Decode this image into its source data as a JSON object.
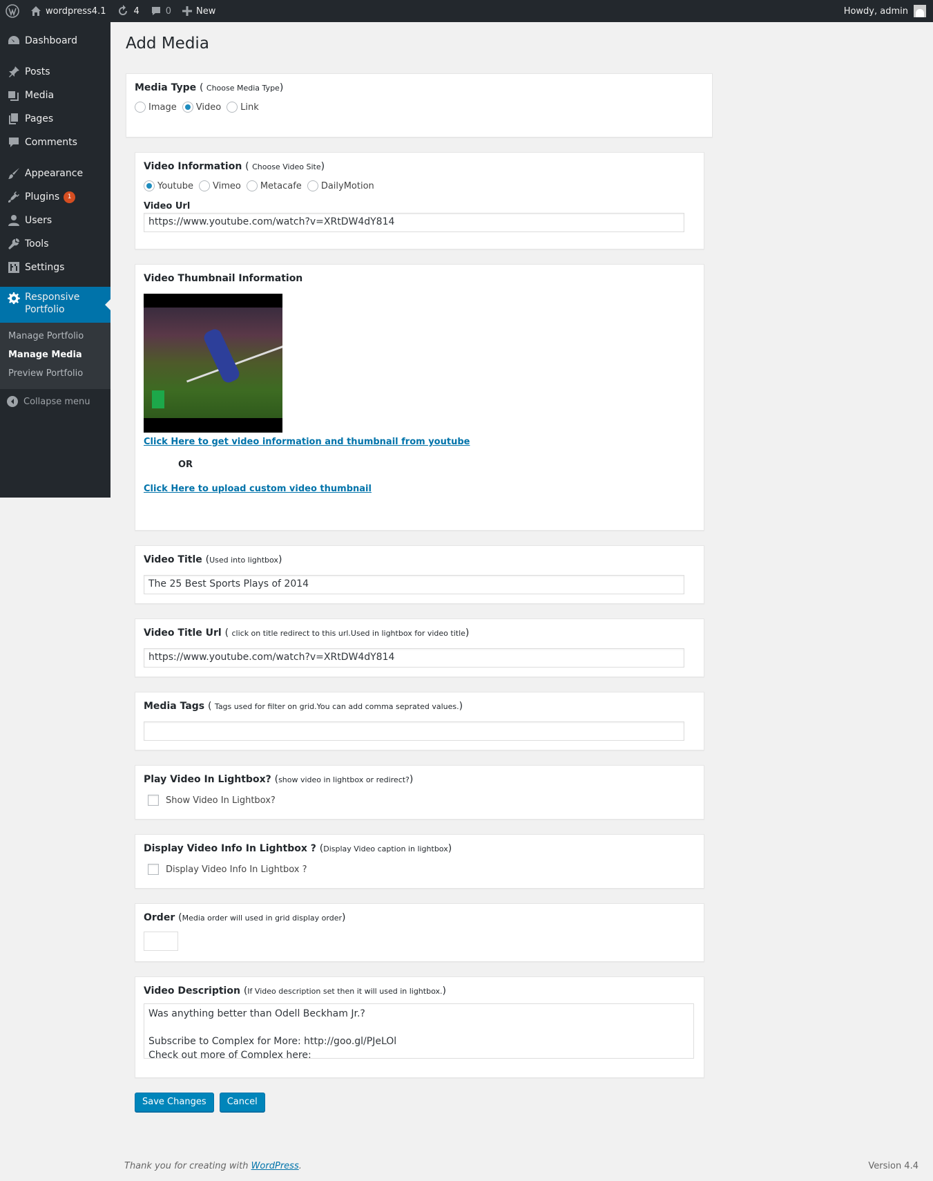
{
  "adminbar": {
    "site_name": "wordpress4.1",
    "updates_count": "4",
    "comments_count": "0",
    "new_label": "New",
    "howdy": "Howdy, admin"
  },
  "sidebar": {
    "items": [
      {
        "label": "Dashboard",
        "icon": "dashboard-icon"
      },
      {
        "label": "Posts",
        "icon": "pin-icon"
      },
      {
        "label": "Media",
        "icon": "media-icon"
      },
      {
        "label": "Pages",
        "icon": "pages-icon"
      },
      {
        "label": "Comments",
        "icon": "comment-icon"
      },
      {
        "label": "Appearance",
        "icon": "brush-icon"
      },
      {
        "label": "Plugins",
        "icon": "plug-icon",
        "badge": "1"
      },
      {
        "label": "Users",
        "icon": "user-icon"
      },
      {
        "label": "Tools",
        "icon": "wrench-icon"
      },
      {
        "label": "Settings",
        "icon": "settings-icon"
      },
      {
        "label": "Responsive Portfolio",
        "icon": "gear-icon"
      }
    ],
    "submenu": [
      "Manage Portfolio",
      "Manage Media",
      "Preview Portfolio"
    ],
    "collapse_label": "Collapse menu"
  },
  "page": {
    "title": "Add Media",
    "media_type": {
      "label": "Media Type",
      "hint": "Choose Media Type",
      "options": [
        "Image",
        "Video",
        "Link"
      ],
      "selected": "Video"
    },
    "video_info": {
      "label": "Video Information",
      "hint": "Choose Video Site",
      "options": [
        "Youtube",
        "Vimeo",
        "Metacafe",
        "DailyMotion"
      ],
      "selected": "Youtube",
      "url_label": "Video Url",
      "url_value": "https://www.youtube.com/watch?v=XRtDW4dY814"
    },
    "thumbnail": {
      "label": "Video Thumbnail Information",
      "link_youtube": "Click Here to get video information and thumbnail from youtube",
      "or": "OR",
      "link_upload": "Click Here to upload custom video thumbnail"
    },
    "video_title": {
      "label": "Video Title",
      "hint": "Used into lightbox",
      "value": "The 25 Best Sports Plays of 2014"
    },
    "video_title_url": {
      "label": "Video Title Url",
      "hint": "click on title redirect to this url.Used in lightbox for video title",
      "value": "https://www.youtube.com/watch?v=XRtDW4dY814"
    },
    "media_tags": {
      "label": "Media Tags",
      "hint": "Tags used for filter on grid.You can add comma seprated values.",
      "value": ""
    },
    "play_lightbox": {
      "label": "Play Video In Lightbox?",
      "hint": "show video in lightbox or redirect?",
      "checkbox_label": "Show Video In Lightbox?"
    },
    "display_info": {
      "label": "Display Video Info In Lightbox ?",
      "hint": "Display Video caption in lightbox",
      "checkbox_label": "Display Video Info In Lightbox ?"
    },
    "order": {
      "label": "Order",
      "hint": "Media order will used in grid display order",
      "value": ""
    },
    "description": {
      "label": "Video Description",
      "hint": "If Video description set then it will used in lightbox.",
      "line1": "Was anything better than Odell Beckham Jr.?",
      "line2": "",
      "line3": "Subscribe to Complex for More: http://goo.gl/PJeLOl",
      "line4": "Check out more of Complex here:"
    },
    "save_label": "Save Changes",
    "cancel_label": "Cancel"
  },
  "footer": {
    "thanks_prefix": "Thank you for creating with ",
    "wordpress_link": "WordPress",
    "thanks_suffix": ".",
    "version": "Version 4.4"
  }
}
